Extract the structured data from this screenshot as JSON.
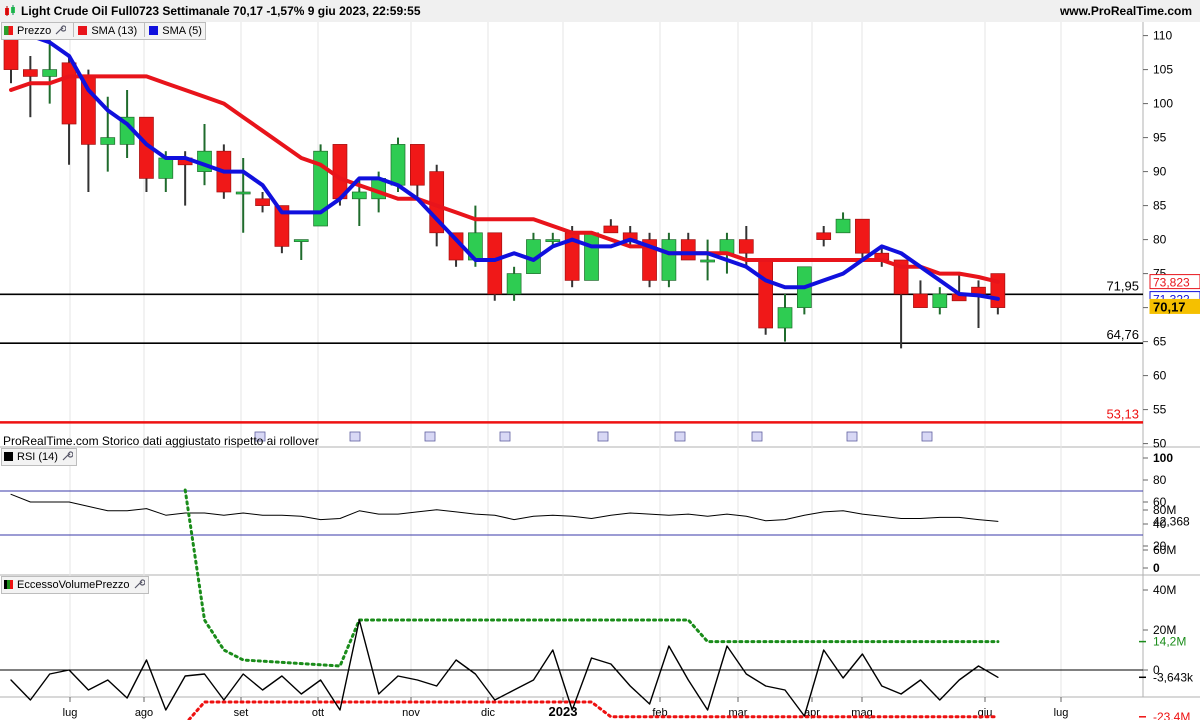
{
  "header": {
    "title": "Light Crude Oil Full0723 Settimanale 70,17 -1,57% 9 giu 2023, 22:59:55",
    "brand": "www.ProRealTime.com"
  },
  "price_panel": {
    "legend": [
      {
        "label": "Prezzo",
        "color": "#2ca02c"
      },
      {
        "label": "SMA (13)",
        "color": "#e8141b"
      },
      {
        "label": "SMA (5)",
        "color": "#1010dd"
      }
    ],
    "note": "ProRealTime.com  Storico dati aggiustato rispetto ai rollover"
  },
  "rsi_panel": {
    "legend": "RSI (14)"
  },
  "volume_panel": {
    "legend": "EccessoVolumePrezzo"
  },
  "colors": {
    "bull": "#2ecc52",
    "bear": "#f01818",
    "sma13": "#e8141b",
    "sma5": "#1010dd",
    "dotted_green": "#1a8c1a",
    "dotted_red": "#ee1111"
  },
  "chart_data": [
    {
      "type": "candlestick",
      "title": "Light Crude Oil Full0723 Settimanale",
      "ylim": [
        50,
        112
      ],
      "y_ticks": [
        50,
        55,
        60,
        65,
        70,
        75,
        80,
        85,
        90,
        95,
        100,
        105,
        110
      ],
      "x_tick_labels": [
        "lug",
        "ago",
        "set",
        "ott",
        "nov",
        "dic",
        "2023",
        "feb",
        "mar",
        "apr",
        "mag",
        "giu",
        "lug"
      ],
      "candles": [
        {
          "o": 111,
          "h": 111,
          "l": 103,
          "c": 105
        },
        {
          "o": 105,
          "h": 107,
          "l": 98,
          "c": 104
        },
        {
          "o": 104,
          "h": 110,
          "l": 100,
          "c": 105
        },
        {
          "o": 106,
          "h": 107,
          "l": 91,
          "c": 97
        },
        {
          "o": 104,
          "h": 105,
          "l": 87,
          "c": 94
        },
        {
          "o": 94,
          "h": 101,
          "l": 90,
          "c": 95
        },
        {
          "o": 94,
          "h": 102,
          "l": 92,
          "c": 98
        },
        {
          "o": 98,
          "h": 98,
          "l": 87,
          "c": 89
        },
        {
          "o": 89,
          "h": 93,
          "l": 87,
          "c": 92
        },
        {
          "o": 92,
          "h": 93,
          "l": 85,
          "c": 91
        },
        {
          "o": 90,
          "h": 97,
          "l": 88,
          "c": 93
        },
        {
          "o": 93,
          "h": 94,
          "l": 86,
          "c": 87
        },
        {
          "o": 87,
          "h": 92,
          "l": 81,
          "c": 87
        },
        {
          "o": 86,
          "h": 87,
          "l": 84,
          "c": 85
        },
        {
          "o": 85,
          "h": 85,
          "l": 78,
          "c": 79
        },
        {
          "o": 80,
          "h": 80,
          "l": 77,
          "c": 80
        },
        {
          "o": 82,
          "h": 94,
          "l": 82,
          "c": 93
        },
        {
          "o": 94,
          "h": 94,
          "l": 85,
          "c": 86
        },
        {
          "o": 86,
          "h": 89,
          "l": 82,
          "c": 87
        },
        {
          "o": 86,
          "h": 90,
          "l": 84,
          "c": 89
        },
        {
          "o": 88,
          "h": 95,
          "l": 87,
          "c": 94
        },
        {
          "o": 94,
          "h": 94,
          "l": 86,
          "c": 88
        },
        {
          "o": 90,
          "h": 91,
          "l": 79,
          "c": 81
        },
        {
          "o": 81,
          "h": 81,
          "l": 76,
          "c": 77
        },
        {
          "o": 77,
          "h": 85,
          "l": 76,
          "c": 81
        },
        {
          "o": 81,
          "h": 81,
          "l": 71,
          "c": 72
        },
        {
          "o": 72,
          "h": 76,
          "l": 71,
          "c": 75
        },
        {
          "o": 75,
          "h": 81,
          "l": 75,
          "c": 80
        },
        {
          "o": 80,
          "h": 81,
          "l": 79,
          "c": 80
        },
        {
          "o": 81,
          "h": 82,
          "l": 73,
          "c": 74
        },
        {
          "o": 74,
          "h": 81,
          "l": 74,
          "c": 81
        },
        {
          "o": 82,
          "h": 83,
          "l": 81,
          "c": 81
        },
        {
          "o": 81,
          "h": 82,
          "l": 79,
          "c": 80
        },
        {
          "o": 80,
          "h": 81,
          "l": 73,
          "c": 74
        },
        {
          "o": 74,
          "h": 81,
          "l": 73,
          "c": 80
        },
        {
          "o": 80,
          "h": 81,
          "l": 77,
          "c": 77
        },
        {
          "o": 77,
          "h": 80,
          "l": 74,
          "c": 77
        },
        {
          "o": 78,
          "h": 81,
          "l": 75,
          "c": 80
        },
        {
          "o": 80,
          "h": 82,
          "l": 76,
          "c": 78
        },
        {
          "o": 77,
          "h": 77,
          "l": 66,
          "c": 67
        },
        {
          "o": 67,
          "h": 72,
          "l": 65,
          "c": 70
        },
        {
          "o": 70,
          "h": 76,
          "l": 69,
          "c": 76
        },
        {
          "o": 81,
          "h": 82,
          "l": 79,
          "c": 80
        },
        {
          "o": 81,
          "h": 84,
          "l": 81,
          "c": 83
        },
        {
          "o": 83,
          "h": 83,
          "l": 77,
          "c": 78
        },
        {
          "o": 78,
          "h": 79,
          "l": 76,
          "c": 77
        },
        {
          "o": 77,
          "h": 77,
          "l": 64,
          "c": 72
        },
        {
          "o": 72,
          "h": 74,
          "l": 70,
          "c": 70
        },
        {
          "o": 70,
          "h": 73,
          "l": 69,
          "c": 72
        },
        {
          "o": 72,
          "h": 75,
          "l": 71,
          "c": 71
        },
        {
          "o": 73,
          "h": 74,
          "l": 67,
          "c": 72
        },
        {
          "o": 75,
          "h": 75,
          "l": 69,
          "c": 70
        }
      ],
      "series": [
        {
          "name": "SMA (13)",
          "values": [
            102,
            103,
            103,
            104,
            104,
            104,
            104,
            104,
            103,
            102,
            101,
            100,
            98,
            96,
            94,
            92,
            91,
            89,
            88,
            87,
            86,
            86,
            85,
            84,
            83,
            83,
            83,
            83,
            82,
            81,
            81,
            80,
            79,
            79,
            78,
            78,
            78,
            78,
            77,
            77,
            77,
            77,
            77,
            77,
            77,
            77,
            76,
            76,
            75,
            75,
            74.5,
            73.8
          ]
        },
        {
          "name": "SMA (5)",
          "values": [
            110,
            110,
            109,
            107,
            102,
            99,
            97,
            94,
            92,
            92,
            91,
            90,
            90,
            88,
            84,
            84,
            84,
            86,
            89,
            89,
            88,
            86,
            83,
            80,
            77,
            77,
            78,
            77,
            79,
            80,
            79,
            79,
            80,
            79,
            78,
            78,
            78,
            77,
            76,
            74,
            73,
            73,
            74,
            75,
            77,
            79,
            78,
            76,
            74,
            72,
            71.8,
            71.3
          ]
        }
      ],
      "horizontal_levels": [
        {
          "value": 71.95,
          "label": "71,95",
          "color": "#000000"
        },
        {
          "value": 64.76,
          "label": "64,76",
          "color": "#000000"
        },
        {
          "value": 53.13,
          "label": "53,13",
          "color": "#ee1111"
        }
      ],
      "axis_badges": [
        {
          "value": 73.823,
          "label": "73,823",
          "color": "#e8141b",
          "style": "outline"
        },
        {
          "value": 71.322,
          "label": "71,322",
          "color": "#1010dd",
          "style": "outline"
        },
        {
          "value": 70.17,
          "label": "70,17",
          "color": "#f5c000",
          "style": "filled"
        }
      ]
    },
    {
      "type": "line",
      "title": "RSI (14)",
      "ylim": [
        0,
        100
      ],
      "y_ticks": [
        0,
        20,
        40,
        60,
        80,
        100
      ],
      "reference_lines": [
        70,
        30
      ],
      "series": [
        {
          "name": "RSI (14)",
          "values": [
            67,
            60,
            60,
            60,
            56,
            52,
            52,
            54,
            48,
            50,
            50,
            48,
            50,
            48,
            48,
            47,
            44,
            45,
            52,
            49,
            49,
            51,
            53,
            51,
            49,
            48,
            44,
            47,
            48,
            47,
            45,
            48,
            50,
            49,
            48,
            49,
            47,
            49,
            47,
            43,
            44,
            48,
            51,
            52,
            49,
            47,
            45,
            45,
            46,
            46,
            44,
            42.368
          ]
        }
      ],
      "axis_badges": [
        {
          "value": 42.368,
          "label": "42,368"
        }
      ]
    },
    {
      "type": "line",
      "title": "EccessoVolumePrezzo",
      "ylim": [
        -28,
        90
      ],
      "y_ticks": [
        0,
        20,
        40,
        60,
        80
      ],
      "y_tick_labels": [
        "0",
        "20M",
        "40M",
        "60M",
        "80M"
      ],
      "zero_line": true,
      "series": [
        {
          "name": "",
          "style": "solid",
          "color": "#000000",
          "values": [
            -5,
            -15,
            -2,
            0,
            -10,
            -5,
            -14,
            5,
            -20,
            -3,
            -2,
            -15,
            -2,
            -10,
            -3,
            -12,
            -5,
            -20,
            25,
            -12,
            -3,
            -5,
            -8,
            5,
            -2,
            -15,
            -10,
            -5,
            10,
            -20,
            6,
            3,
            -8,
            -17,
            12,
            -5,
            -20,
            12,
            -2,
            -8,
            -10,
            -23,
            10,
            -4,
            8,
            -8,
            -12,
            -5,
            -15,
            -5,
            2,
            -3.643
          ]
        },
        {
          "name": "",
          "style": "dotted",
          "color": "#1a8c1a",
          "x": [
            9,
            10,
            11,
            12,
            17,
            18,
            35,
            36,
            51
          ],
          "values": [
            90,
            25,
            10,
            5,
            2,
            25,
            25,
            14.2,
            14.2
          ]
        },
        {
          "name": "",
          "style": "dotted",
          "color": "#ee1111",
          "x": [
            0,
            9,
            10,
            11,
            12,
            30,
            31,
            51
          ],
          "values": [
            -27,
            -27,
            -16,
            -16,
            -16,
            -16,
            -23.4,
            -23.4
          ]
        }
      ],
      "axis_badges": [
        {
          "value": 14.2,
          "label": "14,2M",
          "color": "#1a8c1a"
        },
        {
          "value": -3.643,
          "label": "-3,643k",
          "color": "#000000"
        },
        {
          "value": -23.4,
          "label": "-23,4M",
          "color": "#ee1111"
        }
      ]
    }
  ]
}
